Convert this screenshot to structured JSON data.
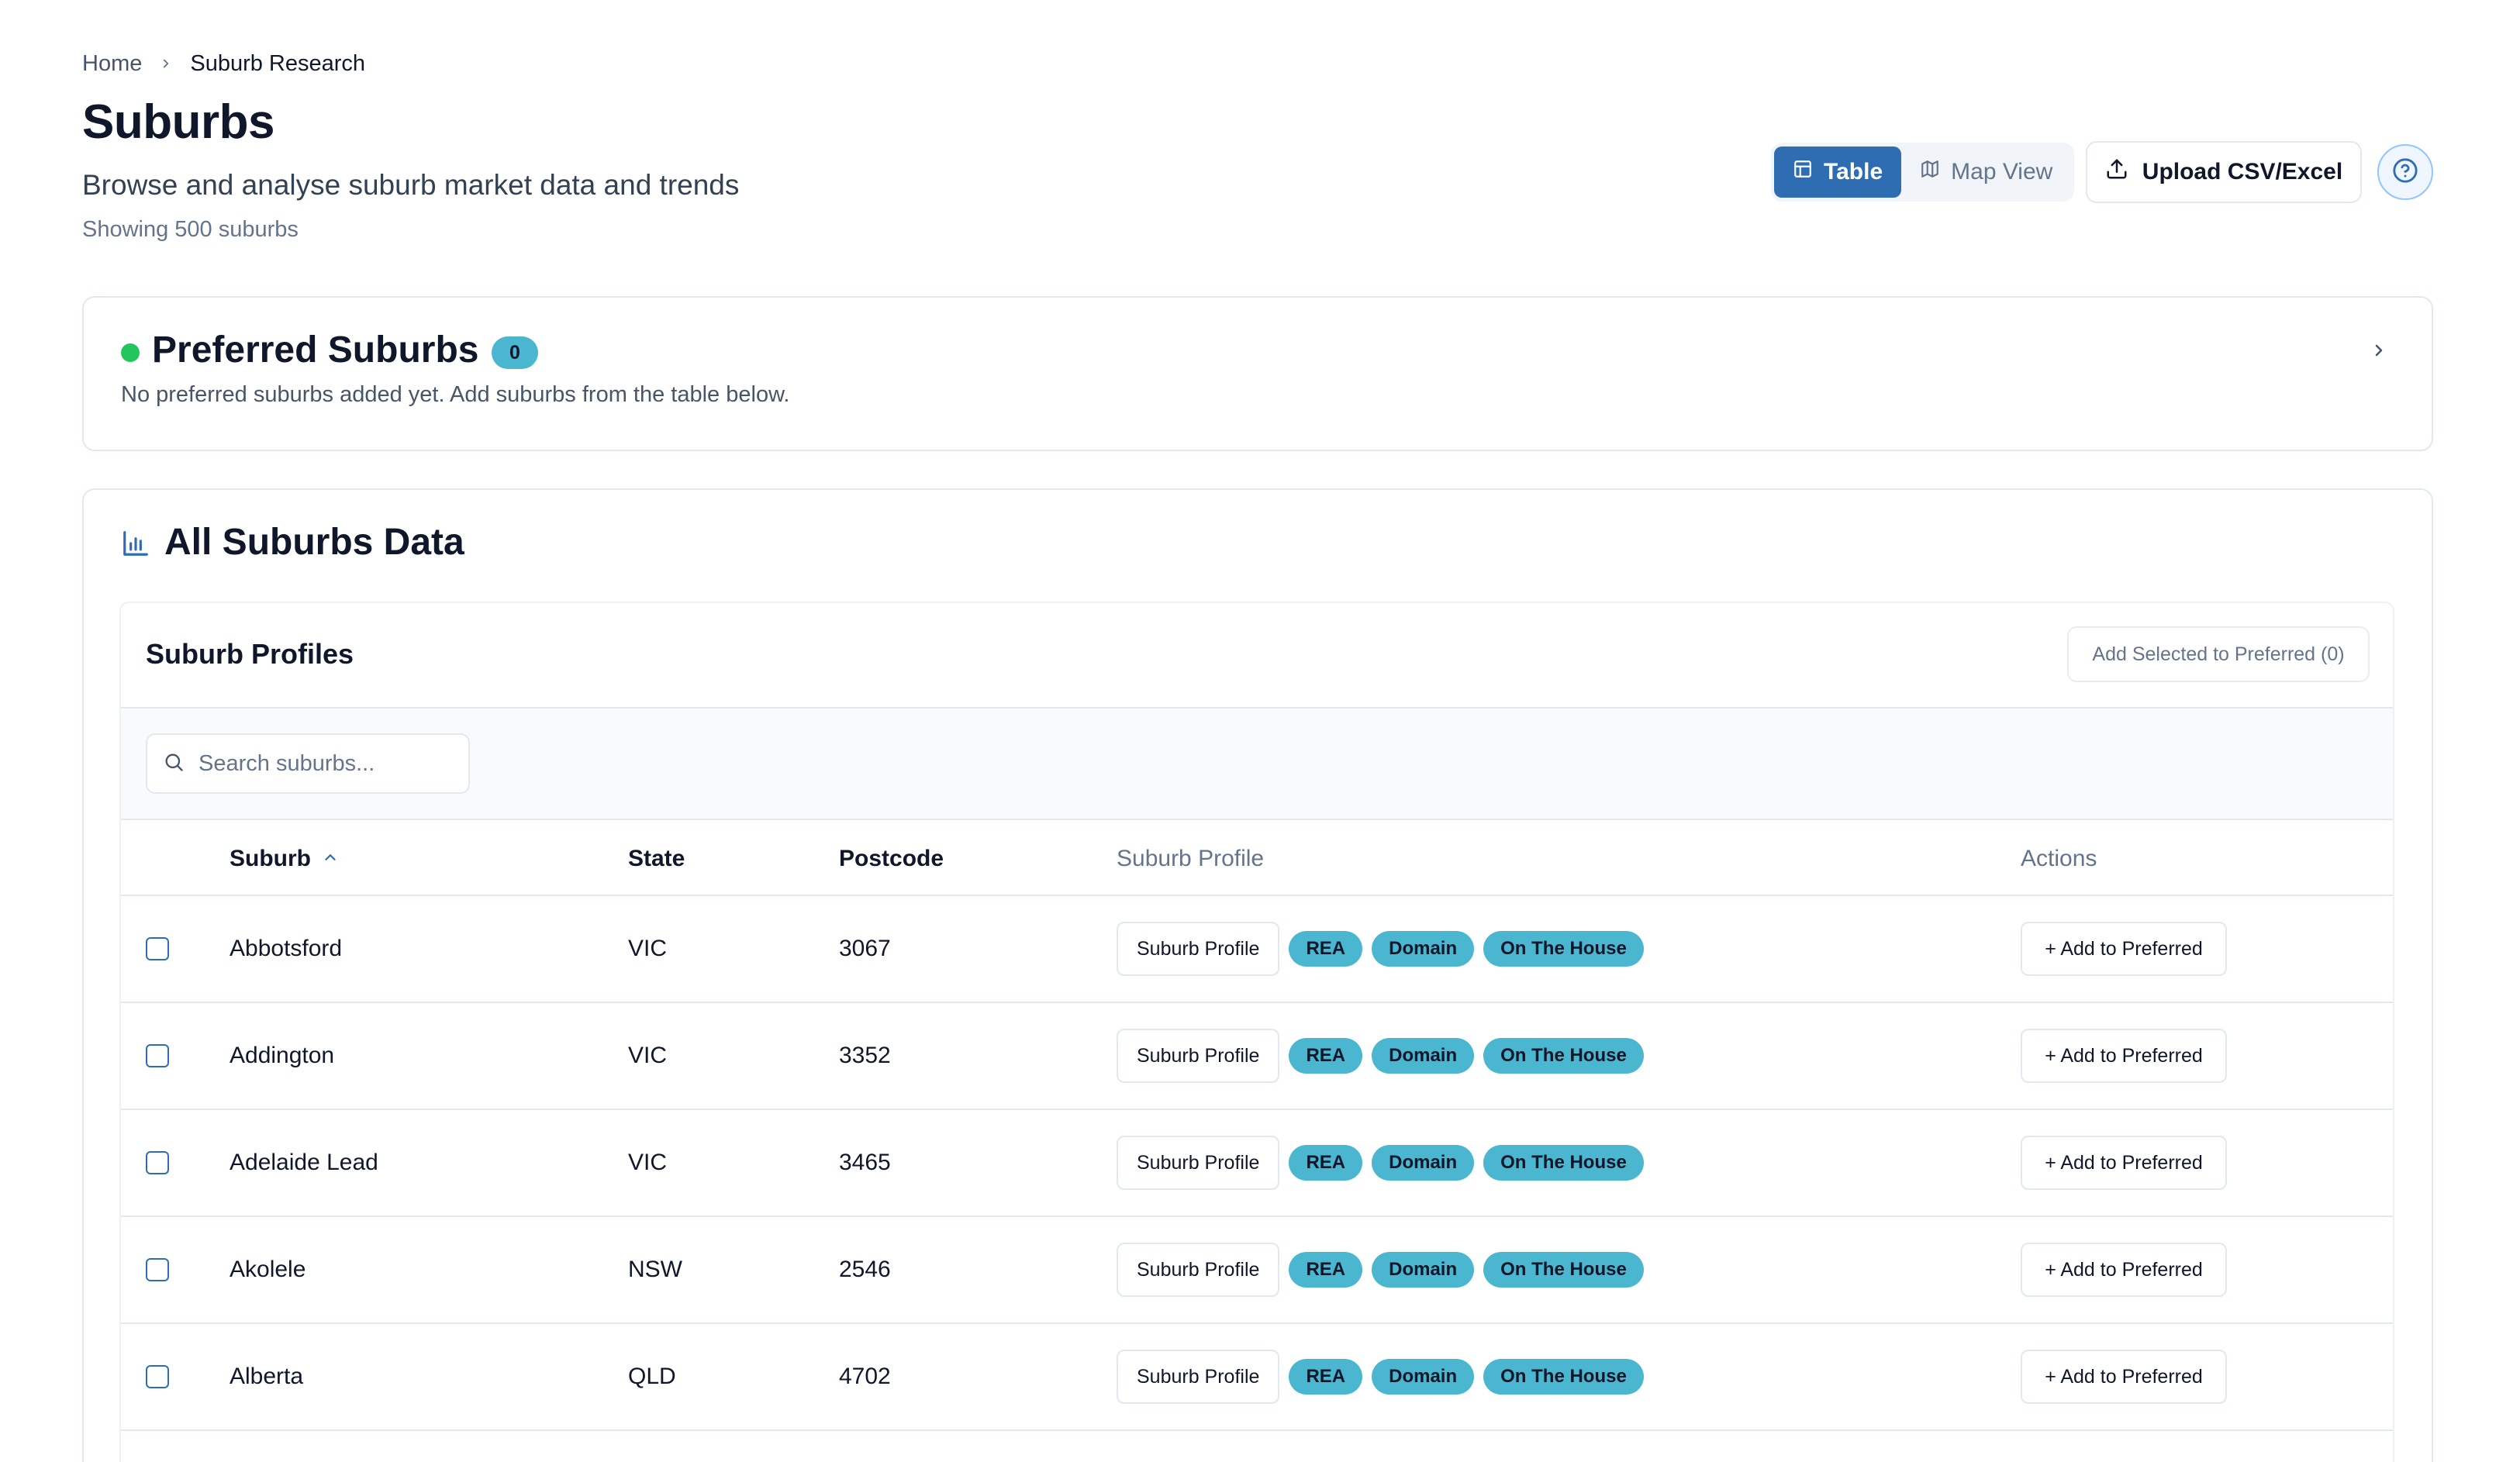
{
  "breadcrumb": {
    "home": "Home",
    "current": "Suburb Research"
  },
  "header": {
    "title": "Suburbs",
    "subtitle": "Browse and analyse suburb market data and trends",
    "count": "Showing 500 suburbs"
  },
  "controls": {
    "table_label": "Table",
    "map_label": "Map View",
    "upload_label": "Upload CSV/Excel",
    "active_view": "Table"
  },
  "preferred": {
    "title": "Preferred Suburbs",
    "count": "0",
    "empty_text": "No preferred suburbs added yet. Add suburbs from the table below."
  },
  "all_data": {
    "title": "All Suburbs Data"
  },
  "profiles": {
    "title": "Suburb Profiles",
    "add_selected_label": "Add Selected to Preferred (0)",
    "search_placeholder": "Search suburbs...",
    "search_value": ""
  },
  "table": {
    "columns": {
      "suburb": "Suburb",
      "state": "State",
      "postcode": "Postcode",
      "profile": "Suburb Profile",
      "actions": "Actions"
    },
    "sort": {
      "column": "Suburb",
      "direction": "ascending"
    },
    "profile_button": "Suburb Profile",
    "pills": [
      "REA",
      "Domain",
      "On The House"
    ],
    "action_label": "+ Add to Preferred",
    "rows": [
      {
        "suburb": "Abbotsford",
        "state": "VIC",
        "postcode": "3067",
        "checked": false
      },
      {
        "suburb": "Addington",
        "state": "VIC",
        "postcode": "3352",
        "checked": false
      },
      {
        "suburb": "Adelaide Lead",
        "state": "VIC",
        "postcode": "3465",
        "checked": false
      },
      {
        "suburb": "Akolele",
        "state": "NSW",
        "postcode": "2546",
        "checked": false
      },
      {
        "suburb": "Alberta",
        "state": "QLD",
        "postcode": "4702",
        "checked": false
      }
    ]
  },
  "colors": {
    "primary": "#2f6db3",
    "pill": "#4ab6d0",
    "preferred_dot": "#22c55e",
    "border": "#e2e8f0"
  },
  "icons": {
    "table": "table-icon",
    "map": "map-icon",
    "upload": "upload-icon",
    "help": "help-circle-icon",
    "chart": "bar-chart-icon",
    "search": "search-icon",
    "sort": "chevron-up-icon",
    "chevron": "chevron-right-icon"
  }
}
